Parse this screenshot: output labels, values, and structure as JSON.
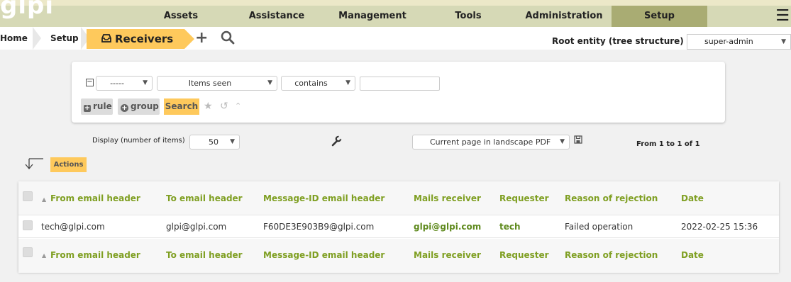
{
  "app": {
    "logo": "glpi"
  },
  "menu": {
    "items": [
      {
        "label": "Assets"
      },
      {
        "label": "Assistance"
      },
      {
        "label": "Management"
      },
      {
        "label": "Tools"
      },
      {
        "label": "Administration"
      },
      {
        "label": "Setup",
        "active": true
      }
    ]
  },
  "breadcrumb": {
    "home": "Home",
    "setup": "Setup",
    "current": "Receivers"
  },
  "header_right": {
    "entity": "Root entity (tree structure)",
    "profile": "super-admin"
  },
  "search": {
    "criteria_link": "-----",
    "field": "Items seen",
    "operator": "contains",
    "value": "",
    "rule_button": "rule",
    "group_button": "group",
    "search_button": "Search"
  },
  "display": {
    "label": "Display (number of items)",
    "count": "50",
    "export": "Current page in landscape PDF",
    "pager": "From 1 to 1 of 1"
  },
  "actions": {
    "label": "Actions"
  },
  "table": {
    "columns": [
      "From email header",
      "To email header",
      "Message-ID email header",
      "Mails receiver",
      "Requester",
      "Reason of rejection",
      "Date"
    ],
    "rows": [
      {
        "from": "tech@glpi.com",
        "to": "glpi@glpi.com",
        "message_id": "F60DE3E903B9@glpi.com",
        "receiver": "glpi@glpi.com",
        "requester": "tech",
        "reason": "Failed operation",
        "date": "2022-02-25 15:36"
      }
    ]
  },
  "colors": {
    "accent": "#fec95c",
    "menu_bg": "#d6d9b6",
    "menu_active": "#a9ac73",
    "header_link": "#7f9f22"
  }
}
